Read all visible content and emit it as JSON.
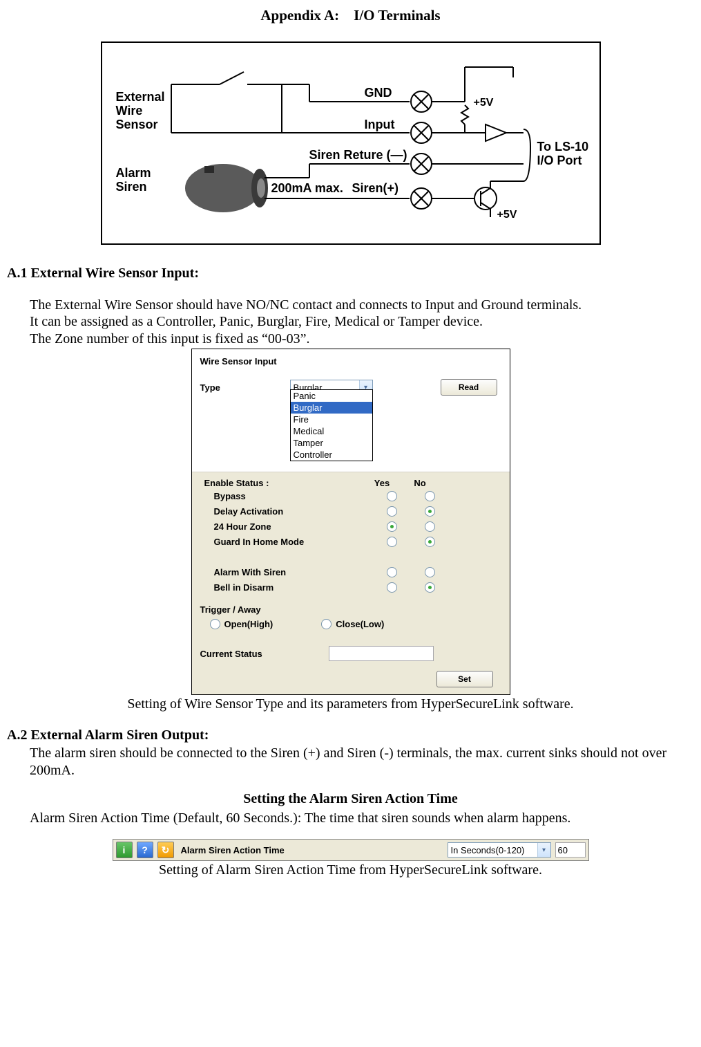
{
  "title": "Appendix A: I/O Terminals",
  "diagram": {
    "externalWire1": "External",
    "externalWire2": "Wire",
    "externalWire3": "Sensor",
    "alarm1": "Alarm",
    "alarm2": "Siren",
    "gnd": "GND",
    "input": "Input",
    "sirenRet": "Siren Reture (—)",
    "max": "200mA max.",
    "sirenPlus": "Siren(+)",
    "plus5a": "+5V",
    "plus5b": "+5V",
    "port1": "To LS-10",
    "port2": "I/O Port"
  },
  "secA1": {
    "heading": "A.1 External Wire Sensor Input:",
    "p1": "The External Wire Sensor should have NO/NC contact and connects to Input and Ground terminals.",
    "p2": "It can be assigned as a Controller, Panic, Burglar, Fire, Medical or Tamper device.",
    "p3": "The Zone number of this input is fixed as “00-03”."
  },
  "panel": {
    "title": "Wire Sensor Input",
    "typeLabel": "Type",
    "typeValue": "Burglar",
    "readBtn": "Read",
    "options": [
      "Panic",
      "Burglar",
      "Fire",
      "Medical",
      "Tamper",
      "Controller"
    ],
    "optionSelected": "Burglar",
    "enableStatus": "Enable Status :",
    "yes": "Yes",
    "no": "No",
    "rows": [
      {
        "label": "Bypass",
        "yes": false,
        "no": false
      },
      {
        "label": "Delay Activation",
        "yes": false,
        "no": true
      },
      {
        "label": "24 Hour Zone",
        "yes": true,
        "no": false
      },
      {
        "label": "Guard In Home Mode",
        "yes": false,
        "no": true
      },
      {
        "label": "",
        "yes": null,
        "no": null
      },
      {
        "label": "Alarm With Siren",
        "yes": false,
        "no": false
      },
      {
        "label": "Bell in Disarm",
        "yes": false,
        "no": true
      }
    ],
    "triggerLabel": "Trigger / Away",
    "openHigh": "Open(High)",
    "closeLow": "Close(Low)",
    "currentStatus": "Current Status",
    "setBtn": "Set"
  },
  "caption1": "Setting of Wire Sensor Type and its parameters from HyperSecureLink software.",
  "secA2": {
    "heading": "A.2 External Alarm Siren Output:",
    "p1": "The alarm siren should be connected to the Siren (+) and Siren (-) terminals, the max. current sinks should not over 200mA."
  },
  "sirenHeading": "Setting the Alarm Siren Action Time",
  "sirenLine": "Alarm Siren Action Time (Default, 60 Seconds.): The time that siren sounds when alarm happens.",
  "bar": {
    "icon1": "i",
    "icon2": "?",
    "icon3": "↻",
    "label": "Alarm Siren Action Time",
    "combo": "In Seconds(0-120)",
    "value": "60"
  },
  "caption2": "Setting of Alarm Siren Action Time from HyperSecureLink software."
}
